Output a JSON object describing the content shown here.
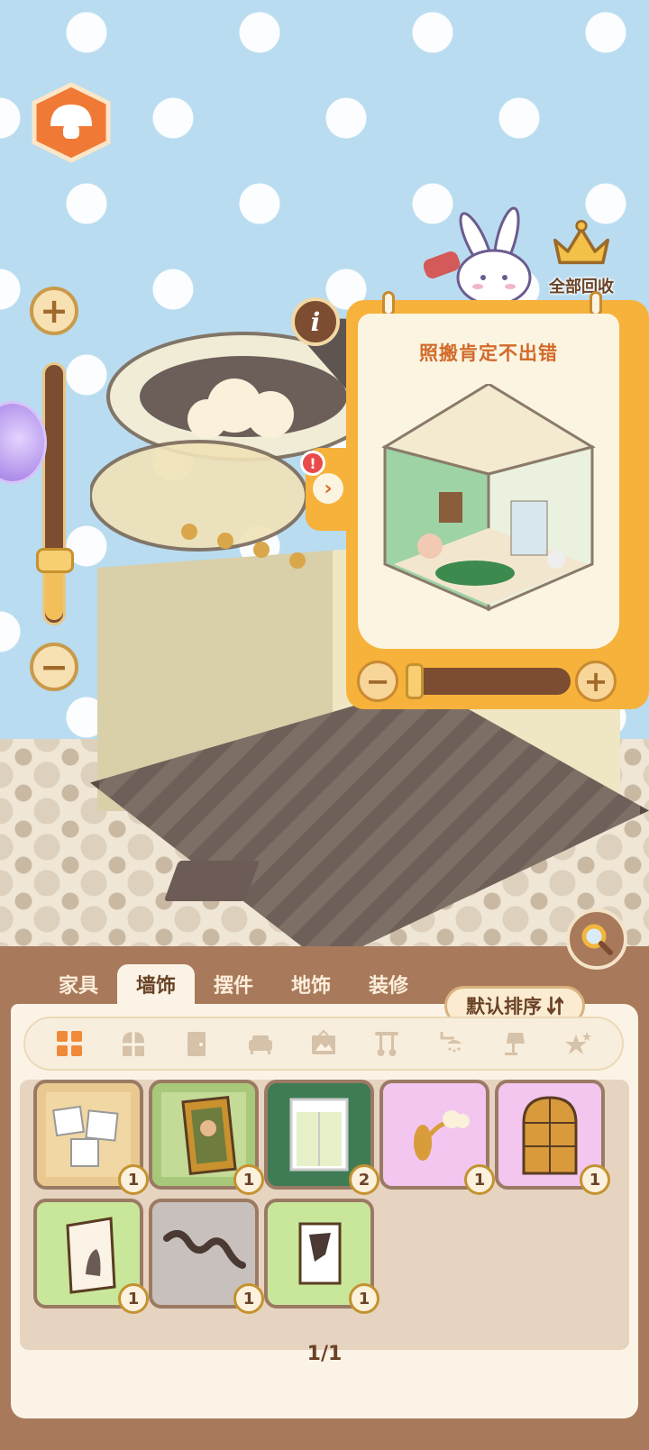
{
  "recycle": {
    "label": "全部回收",
    "icon": "crown-icon"
  },
  "info": {
    "glyph": "i"
  },
  "preview": {
    "title": "照搬肯定不出错",
    "alert": "!",
    "tab_arrow": "›"
  },
  "zoom": {
    "level_fraction": 0.05
  },
  "preview_zoom": {
    "level_fraction": 0.0
  },
  "tabs": [
    {
      "label": "家具",
      "active": false
    },
    {
      "label": "墙饰",
      "active": true
    },
    {
      "label": "摆件",
      "active": false
    },
    {
      "label": "地饰",
      "active": false
    },
    {
      "label": "装修",
      "active": false
    }
  ],
  "sort": {
    "label": "默认排序",
    "icon": "sort-icon"
  },
  "filters": [
    "grid-all-icon",
    "window-icon",
    "door-icon",
    "sofa-icon",
    "picture-icon",
    "utensil-icon",
    "shower-icon",
    "lamp-icon",
    "star-icon"
  ],
  "items": [
    {
      "name": "photo-clips-wall",
      "count": "1",
      "bg": "#e9c98f"
    },
    {
      "name": "portrait-painting",
      "count": "1",
      "bg": "#a9c97a"
    },
    {
      "name": "window-curtain",
      "count": "2",
      "bg": "#3f7c55"
    },
    {
      "name": "cloud-wall-lamp",
      "count": "1",
      "bg": "#f2c6ee"
    },
    {
      "name": "arched-window",
      "count": "1",
      "bg": "#f2c6ee"
    },
    {
      "name": "cat-canvas",
      "count": "1",
      "bg": "#c9e79a"
    },
    {
      "name": "snake-rail",
      "count": "1",
      "bg": "#c8c0bc"
    },
    {
      "name": "abstract-frame",
      "count": "1",
      "bg": "#c9e79a"
    }
  ],
  "pagination": {
    "text": "1/1"
  },
  "colors": {
    "panel": "#a8795a",
    "accent": "#f6b23b",
    "text": "#6a4327"
  }
}
